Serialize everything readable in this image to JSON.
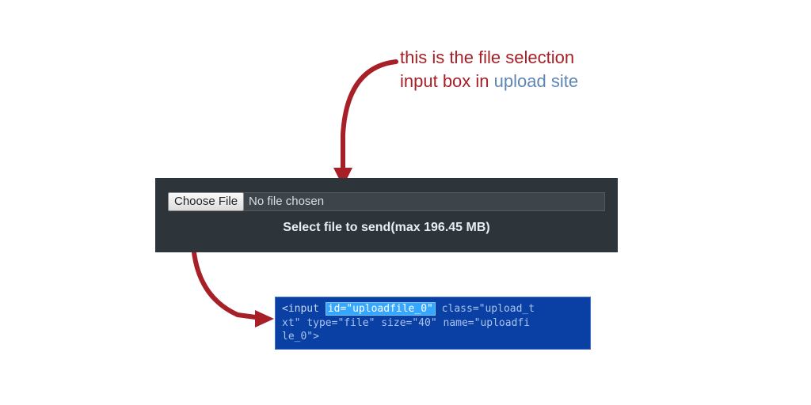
{
  "annotation": {
    "line1": "this is the file selection",
    "line2_pre": "input box in ",
    "line2_link": "upload site"
  },
  "panel": {
    "choose_label": "Choose File",
    "file_name": "No file chosen",
    "hint": "Select file to send(max 196.45 MB)"
  },
  "devtools": {
    "pre": "<input ",
    "highlight": "id=\"uploadfile_0\"",
    "post1": " class=\"upload_t",
    "post2": "xt\" type=\"file\" size=\"40\" name=\"uploadfi",
    "post3": "le_0\">"
  }
}
